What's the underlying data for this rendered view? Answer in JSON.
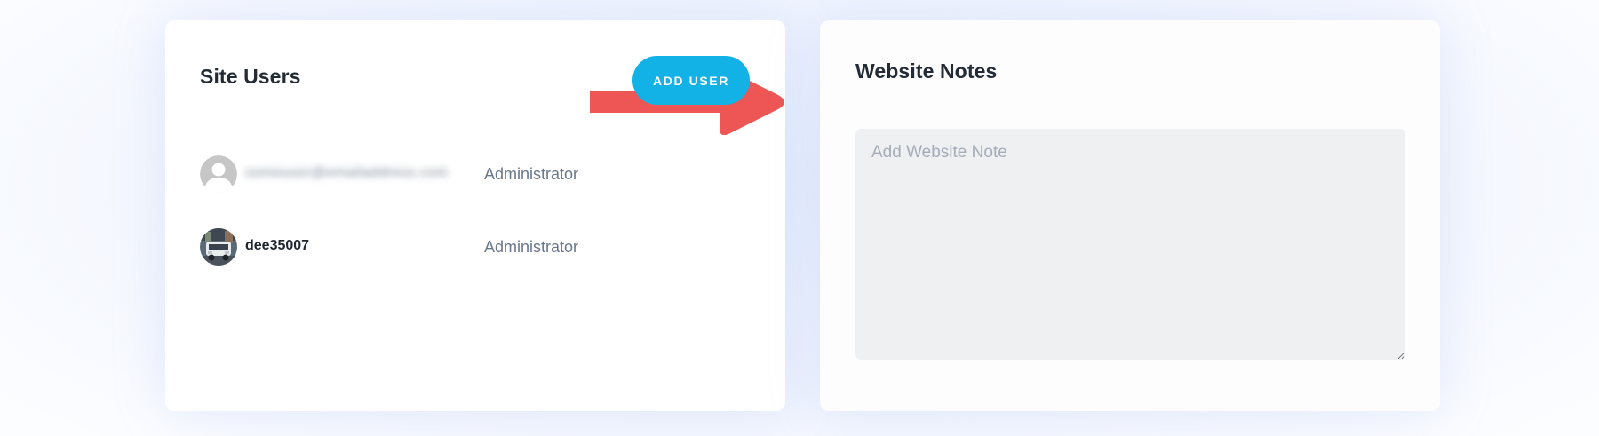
{
  "site_users": {
    "title": "Site Users",
    "add_button_label": "ADD USER",
    "users": [
      {
        "name": "someuser@emailaddress.com",
        "role": "Administrator",
        "avatar": "default-avatar-icon",
        "name_obscured": true
      },
      {
        "name": "dee35007",
        "role": "Administrator",
        "avatar": "photo-avatar",
        "name_obscured": false
      }
    ]
  },
  "website_notes": {
    "title": "Website Notes",
    "placeholder": "Add Website Note",
    "value": ""
  },
  "colors": {
    "accent": "#12b1e6",
    "annotation_arrow": "#ee5655",
    "role_text": "#69788d",
    "notes_background": "#eff0f2"
  }
}
